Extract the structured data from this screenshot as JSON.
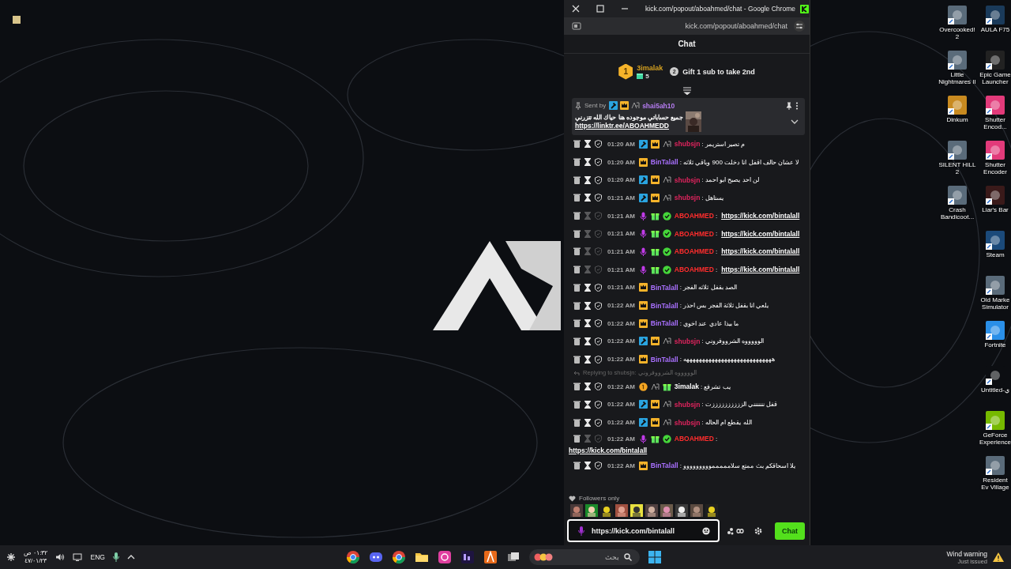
{
  "browser": {
    "title": "kick.com/popout/aboahmed/chat - Google Chrome",
    "address": "kick.com/popout/aboahmed/chat"
  },
  "chat": {
    "header": "Chat",
    "leaderboard": {
      "rank": "1",
      "user": "3imalak",
      "gifts": "5",
      "next_rank": "2",
      "next_text": "Gift 1 sub to take 2nd"
    },
    "pinned": {
      "label": "Sent by",
      "badges": [
        {
          "kind": "mod"
        },
        {
          "kind": "sub"
        },
        {
          "kind": "og"
        }
      ],
      "user": "shai5ah10",
      "color": "#b57cf0",
      "text": "جميع حساباتي موجوده هنا حياك الله تتزرني",
      "link": "https://linktr.ee/ABOAHMEDD"
    },
    "messages": [
      {
        "time": "01:20 AM",
        "actions_dimmed": false,
        "badges": [
          {
            "kind": "mod"
          },
          {
            "kind": "sub"
          },
          {
            "kind": "og"
          }
        ],
        "user": "shubsjn",
        "color": "#e0245e",
        "text": ": م تصير استريمر"
      },
      {
        "time": "01:20 AM",
        "actions_dimmed": false,
        "badges": [
          {
            "kind": "sub"
          }
        ],
        "user": "BinTalall",
        "color": "#a970ff",
        "text": ": لا عشان حالف اقفل انا دخلت 900 وباقي ثلاثه"
      },
      {
        "time": "01:20 AM",
        "actions_dimmed": false,
        "badges": [
          {
            "kind": "mod"
          },
          {
            "kind": "sub"
          },
          {
            "kind": "og"
          }
        ],
        "user": "shubsjn",
        "color": "#e0245e",
        "text": ": لن احد يصبح ابو احمد"
      },
      {
        "time": "01:21 AM",
        "actions_dimmed": false,
        "badges": [
          {
            "kind": "mod"
          },
          {
            "kind": "sub"
          },
          {
            "kind": "og"
          }
        ],
        "user": "shubsjn",
        "color": "#e0245e",
        "text": ": يستاهل"
      },
      {
        "time": "01:21 AM",
        "actions_dimmed": true,
        "badges": [
          {
            "kind": "mic"
          },
          {
            "kind": "gift"
          },
          {
            "kind": "verified"
          }
        ],
        "user": "ABOAHMED",
        "color": "#ff2d2d",
        "text": ":",
        "link": "https://kick.com/bintalall"
      },
      {
        "time": "01:21 AM",
        "actions_dimmed": true,
        "badges": [
          {
            "kind": "mic"
          },
          {
            "kind": "gift"
          },
          {
            "kind": "verified"
          }
        ],
        "user": "ABOAHMED",
        "color": "#ff2d2d",
        "text": ":",
        "link": "https://kick.com/bintalall"
      },
      {
        "time": "01:21 AM",
        "actions_dimmed": true,
        "badges": [
          {
            "kind": "mic"
          },
          {
            "kind": "gift"
          },
          {
            "kind": "verified"
          }
        ],
        "user": "ABOAHMED",
        "color": "#ff2d2d",
        "text": ":",
        "link": "https://kick.com/bintalall"
      },
      {
        "time": "01:21 AM",
        "actions_dimmed": true,
        "badges": [
          {
            "kind": "mic"
          },
          {
            "kind": "gift"
          },
          {
            "kind": "verified"
          }
        ],
        "user": "ABOAHMED",
        "color": "#ff2d2d",
        "text": ":",
        "link": "https://kick.com/bintalall"
      },
      {
        "time": "01:21 AM",
        "actions_dimmed": false,
        "badges": [
          {
            "kind": "sub"
          }
        ],
        "user": "BinTalall",
        "color": "#a970ff",
        "text": ": الصد بقفل ثلاثه الفجر"
      },
      {
        "time": "01:22 AM",
        "actions_dimmed": false,
        "badges": [
          {
            "kind": "sub"
          }
        ],
        "user": "BinTalall",
        "color": "#a970ff",
        "text": ": يلعي انا بقفل ثلاثة الفجر بس احذر"
      },
      {
        "time": "01:22 AM",
        "actions_dimmed": false,
        "badges": [
          {
            "kind": "sub"
          }
        ],
        "user": "BinTalall",
        "color": "#a970ff",
        "text": ": ما بيذا عادي عند اخوي"
      },
      {
        "time": "01:22 AM",
        "actions_dimmed": false,
        "badges": [
          {
            "kind": "mod"
          },
          {
            "kind": "sub"
          },
          {
            "kind": "og"
          }
        ],
        "user": "shubsjn",
        "color": "#e0245e",
        "text": ": الوووووه الشرووفروني"
      },
      {
        "time": "01:22 AM",
        "actions_dimmed": false,
        "badges": [
          {
            "kind": "sub"
          }
        ],
        "user": "BinTalall",
        "color": "#a970ff",
        "text": ": ههههههههههههههههههههههههههههه"
      },
      {
        "reply": "Replying to shubsjn: الوووووه الشرووفروني",
        "time": "01:22 AM",
        "actions_dimmed": false,
        "badges": [
          {
            "kind": "rank1"
          },
          {
            "kind": "og"
          },
          {
            "kind": "gift"
          }
        ],
        "user": "3imalak",
        "color": "#ffffff",
        "text": ": يب تشرفع"
      },
      {
        "time": "01:22 AM",
        "actions_dimmed": false,
        "badges": [
          {
            "kind": "mod"
          },
          {
            "kind": "sub"
          },
          {
            "kind": "og"
          }
        ],
        "user": "shubsjn",
        "color": "#e0245e",
        "text": ": قفل ننننننني الززززززززززت"
      },
      {
        "time": "01:22 AM",
        "actions_dimmed": false,
        "badges": [
          {
            "kind": "mod"
          },
          {
            "kind": "sub"
          },
          {
            "kind": "og"
          }
        ],
        "user": "shubsjn",
        "color": "#e0245e",
        "text": ": الله يقطع ام الحاله"
      },
      {
        "time": "01:22 AM",
        "actions_dimmed": true,
        "badges": [
          {
            "kind": "mic"
          },
          {
            "kind": "gift"
          },
          {
            "kind": "verified"
          }
        ],
        "user": "ABOAHMED",
        "color": "#ff2d2d",
        "text": ":",
        "link": "https://kick.com/bintalall",
        "wrap": true
      },
      {
        "time": "01:22 AM",
        "actions_dimmed": false,
        "badges": [
          {
            "kind": "sub"
          }
        ],
        "user": "BinTalall",
        "color": "#a970ff",
        "text": ": يلا اسحاقكم بث ممتع سلامممممووووووووو"
      }
    ],
    "mode": "Followers only",
    "input": {
      "value": "https://kick.com/bintalall"
    },
    "send": "Chat"
  },
  "desktop_icons": [
    {
      "label": "Overcooked! 2",
      "kind": "game"
    },
    {
      "label": "AULA F75",
      "kind": "keyboard"
    },
    {
      "label": "Little Nightmares II",
      "kind": "game"
    },
    {
      "label": "Epic Game Launcher",
      "kind": "epic"
    },
    {
      "label": "Dinkum",
      "kind": "dinkum"
    },
    {
      "label": "Shutter Encod...",
      "kind": "shutter"
    },
    {
      "label": "SILENT HILL 2",
      "kind": "game"
    },
    {
      "label": "Shutter Encoder",
      "kind": "shutter"
    },
    {
      "label": "Crash Bandicoot...",
      "kind": "game"
    },
    {
      "label": "Liar's Bar",
      "kind": "liar"
    },
    {
      "kind": "none"
    },
    {
      "label": "Steam",
      "kind": "steam"
    },
    {
      "kind": "none"
    },
    {
      "label": "Old Marke Simulator",
      "kind": "game"
    },
    {
      "kind": "none"
    },
    {
      "label": "Fortnite",
      "kind": "fortnite"
    },
    {
      "kind": "none"
    },
    {
      "label": "Untitled-ي",
      "kind": "blank"
    },
    {
      "kind": "none"
    },
    {
      "label": "GeForce Experience",
      "kind": "nvidia"
    },
    {
      "kind": "none"
    },
    {
      "label": "Resident Ev Village",
      "kind": "game"
    }
  ],
  "taskbar": {
    "time": "٠١:٣٢ ص",
    "date": "٤٧/٠١/٢٣",
    "language": "ENG",
    "search": "بحث",
    "weather_title": "Wind warning",
    "weather_sub": "Just issued"
  }
}
